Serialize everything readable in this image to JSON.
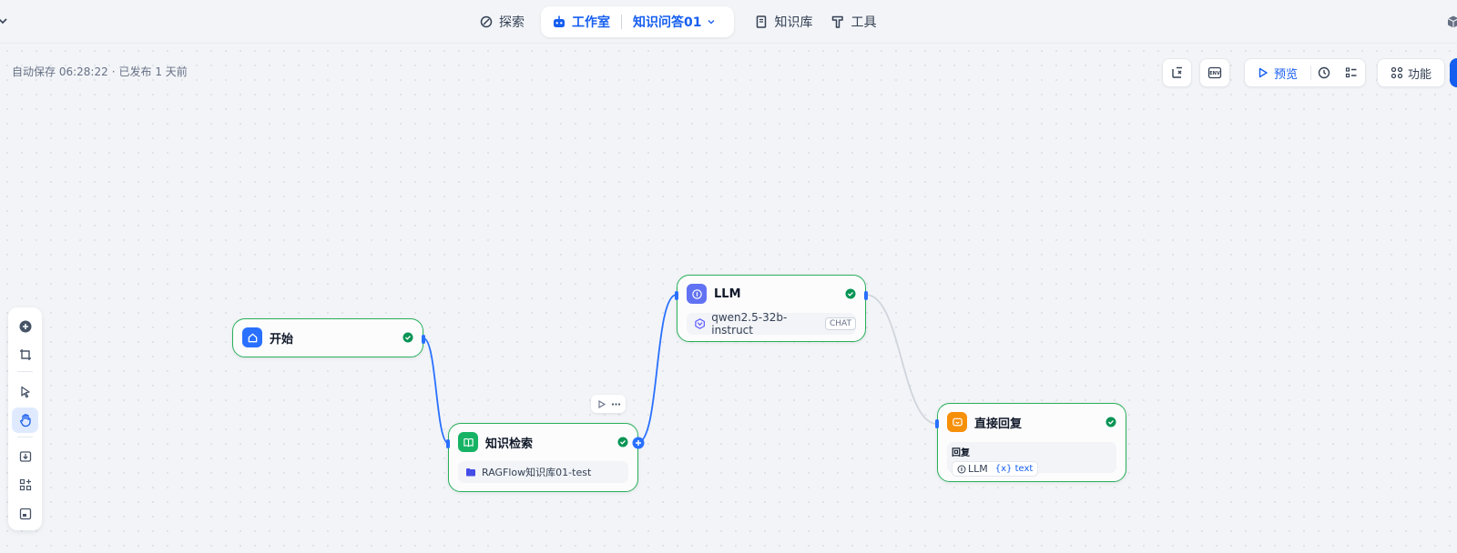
{
  "header": {
    "nav": {
      "explore": "探索",
      "studio": "工作室",
      "app_name": "知识问答01",
      "knowledge": "知识库",
      "tools": "工具"
    }
  },
  "status": {
    "autosave": "自动保存 06:28:22",
    "separator": "·",
    "published": "已发布 1 天前"
  },
  "toolbar": {
    "preview": "预览",
    "features": "功能"
  },
  "nodes": {
    "start": {
      "title": "开始"
    },
    "knowledge": {
      "title": "知识检索",
      "dataset": "RAGFlow知识库01-test"
    },
    "llm": {
      "title": "LLM",
      "model": "qwen2.5-32b-instruct",
      "mode_tag": "CHAT"
    },
    "answer": {
      "title": "直接回复",
      "label": "回复",
      "source_node": "LLM",
      "variable": "{x} text"
    }
  },
  "colors": {
    "accent": "#155eef",
    "node_border": "#29b05a",
    "start_icon": "#2970ff",
    "knowledge_icon": "#16b364",
    "llm_icon": "#6172f3",
    "answer_icon": "#f79009"
  },
  "icons": {
    "explore": "compass-icon",
    "studio": "robot-icon",
    "knowledge": "book-icon",
    "tools": "hammer-icon"
  }
}
